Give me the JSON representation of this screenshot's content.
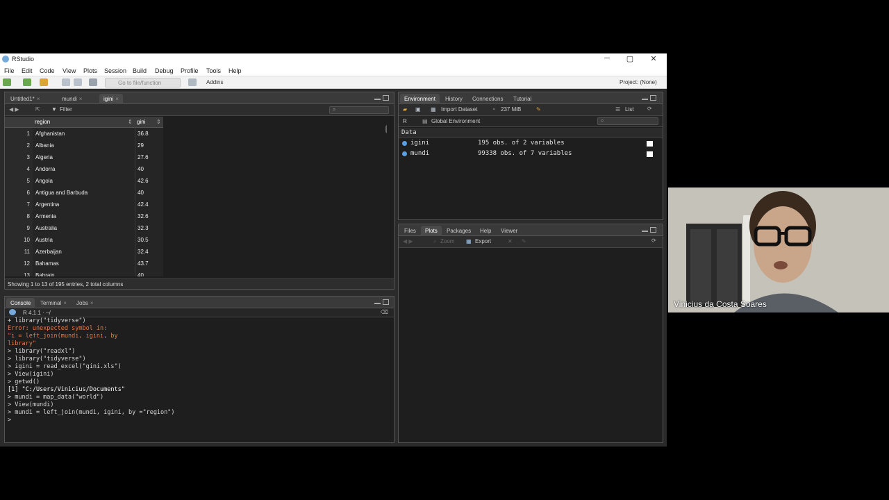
{
  "window": {
    "title": "RStudio",
    "minimize": "─",
    "maximize": "▢",
    "close": "✕"
  },
  "menu": [
    "File",
    "Edit",
    "Code",
    "View",
    "Plots",
    "Session",
    "Build",
    "Debug",
    "Profile",
    "Tools",
    "Help"
  ],
  "toolbar": {
    "goto_placeholder": "Go to file/function",
    "addins": "Addins",
    "project": "Project: (None)"
  },
  "source_pane": {
    "tabs": [
      {
        "label": "Untitled1*",
        "active": false
      },
      {
        "label": "mundi",
        "active": false
      },
      {
        "label": "igini",
        "active": true
      }
    ],
    "filter_label": "Filter",
    "columns": [
      "region",
      "gini"
    ],
    "rows": [
      {
        "n": "1",
        "region": "Afghanistan",
        "gini": "36.8"
      },
      {
        "n": "2",
        "region": "Albania",
        "gini": "29"
      },
      {
        "n": "3",
        "region": "Algeria",
        "gini": "27.6"
      },
      {
        "n": "4",
        "region": "Andorra",
        "gini": "40"
      },
      {
        "n": "5",
        "region": "Angola",
        "gini": "42.6"
      },
      {
        "n": "6",
        "region": "Antigua and Barbuda",
        "gini": "40"
      },
      {
        "n": "7",
        "region": "Argentina",
        "gini": "42.4"
      },
      {
        "n": "8",
        "region": "Armenia",
        "gini": "32.6"
      },
      {
        "n": "9",
        "region": "Australia",
        "gini": "32.3"
      },
      {
        "n": "10",
        "region": "Austria",
        "gini": "30.5"
      },
      {
        "n": "11",
        "region": "Azerbaijan",
        "gini": "32.4"
      },
      {
        "n": "12",
        "region": "Bahamas",
        "gini": "43.7"
      },
      {
        "n": "13",
        "region": "Bahrain",
        "gini": "40"
      }
    ],
    "footer": "Showing 1 to 13 of 195 entries, 2 total columns"
  },
  "console_pane": {
    "tabs": [
      {
        "label": "Console",
        "active": true
      },
      {
        "label": "Terminal",
        "active": false
      },
      {
        "label": "Jobs",
        "active": false
      }
    ],
    "r_version": "R 4.1.1 · ~/",
    "lines": [
      {
        "kind": "in",
        "text": "+ library(\"tidyverse\")"
      },
      {
        "kind": "err",
        "text": "Error: unexpected symbol in:"
      },
      {
        "kind": "err",
        "text": "\"i = left_join(mundi, igini, by"
      },
      {
        "kind": "err",
        "text": "library\""
      },
      {
        "kind": "in",
        "text": "> library(\"readxl\")"
      },
      {
        "kind": "in",
        "text": "> library(\"tidyverse\")"
      },
      {
        "kind": "in",
        "text": "> igini = read_excel(\"gini.xls\")"
      },
      {
        "kind": "in",
        "text": "> View(igini)"
      },
      {
        "kind": "in",
        "text": "> getwd()"
      },
      {
        "kind": "out",
        "text": "[1] \"C:/Users/Vinicius/Documents\""
      },
      {
        "kind": "in",
        "text": "> mundi = map_data(\"world\")"
      },
      {
        "kind": "in",
        "text": "> View(mundi)"
      },
      {
        "kind": "in",
        "text": "> mundi = left_join(mundi, igini, by =\"region\")"
      },
      {
        "kind": "in",
        "text": "> "
      }
    ]
  },
  "env_pane": {
    "tabs": [
      {
        "label": "Environment",
        "active": true
      },
      {
        "label": "History",
        "active": false
      },
      {
        "label": "Connections",
        "active": false
      },
      {
        "label": "Tutorial",
        "active": false
      }
    ],
    "import_label": "Import Dataset",
    "memory": "237 MiB",
    "list_label": "List",
    "lang": "R",
    "scope": "Global Environment",
    "section": "Data",
    "objects": [
      {
        "name": "igini",
        "desc": "195 obs. of 2 variables"
      },
      {
        "name": "mundi",
        "desc": "99338 obs. of 7 variables"
      }
    ]
  },
  "files_pane": {
    "tabs": [
      {
        "label": "Files",
        "active": false
      },
      {
        "label": "Plots",
        "active": true
      },
      {
        "label": "Packages",
        "active": false
      },
      {
        "label": "Help",
        "active": false
      },
      {
        "label": "Viewer",
        "active": false
      }
    ],
    "zoom_label": "Zoom",
    "export_label": "Export"
  },
  "webcam": {
    "name": "Vinicius da Costa Soares"
  },
  "colors": {
    "accent": "#75aadb",
    "error": "#e07b4e",
    "object_dot": "#5aa0e6"
  }
}
